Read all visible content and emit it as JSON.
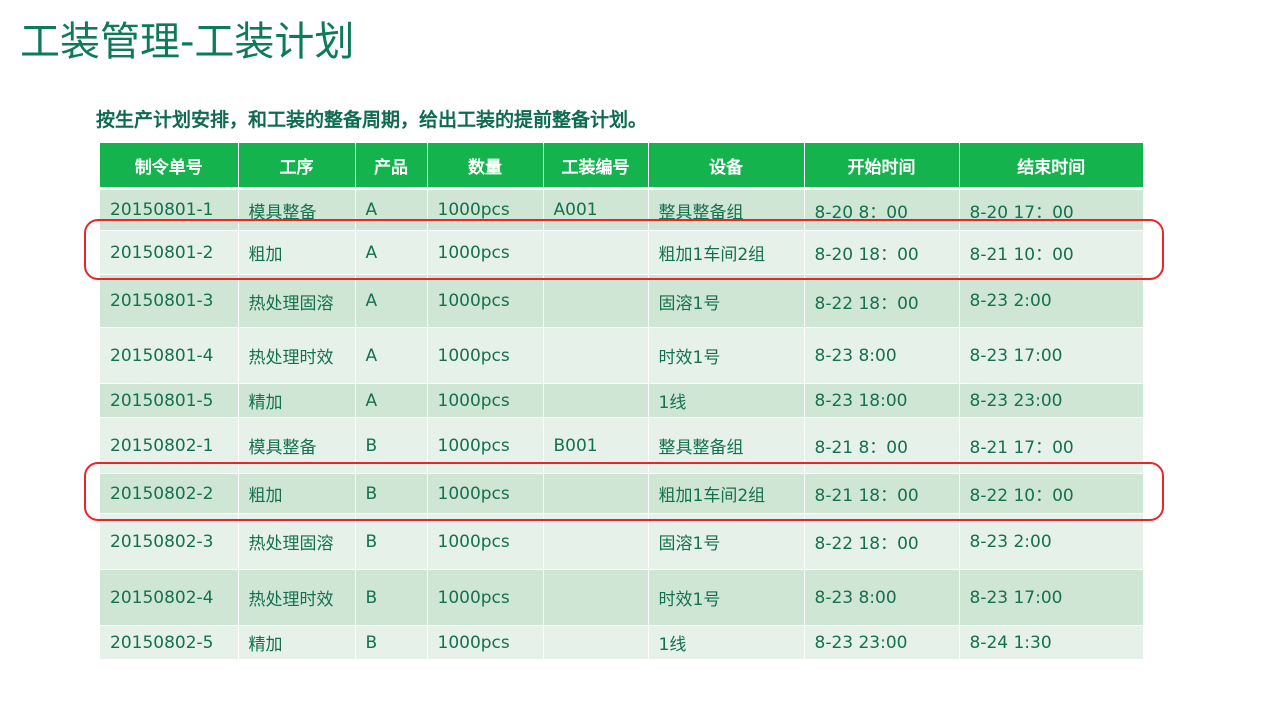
{
  "title": "工装管理-工装计划",
  "subtitle": "按生产计划安排，和工装的整备周期，给出工装的提前整备计划。",
  "colors": {
    "header_bg": "#14b34e",
    "title_text": "#0f7a5a",
    "row_odd": "#cfe6d5",
    "row_even": "#e6f2e9",
    "highlight": "#e8262a"
  },
  "table": {
    "headers": [
      "制令单号",
      "工序",
      "产品",
      "数量",
      "工装编号",
      "设备",
      "开始时间",
      "结束时间"
    ],
    "rows": [
      [
        "20150801-1",
        "模具整备",
        "A",
        "1000pcs",
        "A001",
        "整具整备组",
        "8-20 8：00",
        "8-20 17：00"
      ],
      [
        "20150801-2",
        "粗加",
        "A",
        "1000pcs",
        "",
        "粗加1车间2组",
        "8-20 18：00",
        "8-21 10：00"
      ],
      [
        "20150801-3",
        "热处理固溶",
        "A",
        "1000pcs",
        "",
        "固溶1号",
        "8-22 18：00",
        "8-23 2:00"
      ],
      [
        "20150801-4",
        "热处理时效",
        "A",
        "1000pcs",
        "",
        "时效1号",
        "8-23 8:00",
        "8-23 17:00"
      ],
      [
        "20150801-5",
        "精加",
        "A",
        "1000pcs",
        "",
        "1线",
        "8-23 18:00",
        "8-23 23:00"
      ],
      [
        "20150802-1",
        "模具整备",
        "B",
        "1000pcs",
        "B001",
        "整具整备组",
        "8-21 8：00",
        "8-21 17：00"
      ],
      [
        "20150802-2",
        "粗加",
        "B",
        "1000pcs",
        "",
        "粗加1车间2组",
        "8-21 18：00",
        "8-22 10：00"
      ],
      [
        "20150802-3",
        "热处理固溶",
        "B",
        "1000pcs",
        "",
        "固溶1号",
        "8-22 18：00",
        "8-23 2:00"
      ],
      [
        "20150802-4",
        "热处理时效",
        "B",
        "1000pcs",
        "",
        "时效1号",
        "8-23 8:00",
        "8-23 17:00"
      ],
      [
        "20150802-5",
        "精加",
        "B",
        "1000pcs",
        "",
        "1线",
        "8-23 23:00",
        "8-24 1:30"
      ]
    ]
  }
}
